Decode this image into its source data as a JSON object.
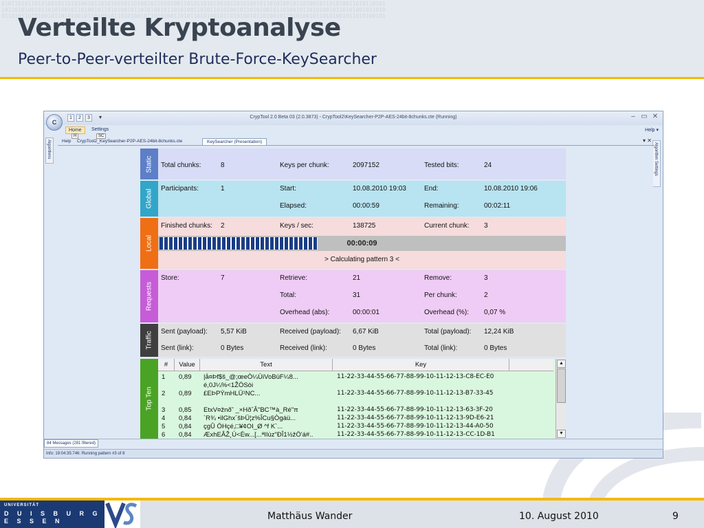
{
  "slide": {
    "title": "Verteilte Kryptoanalyse",
    "subtitle": "Peer-to-Peer-verteilter Brute-Force-KeySearcher",
    "binary_pattern": "01011010110101001011010100101101010010110100101101010011010110101001011010100101101010010110100101101010011010110101\n10110101001011010100101101001011010100101101010010110101001101011010100101101010010110100101101010010110101001011010\n01101011010100101101010010110100101101010010110101001101011010100101101010010110100101101010010110101001011010100101"
  },
  "window": {
    "orb_label": "C",
    "quick_access": [
      "1",
      "2",
      "3"
    ],
    "qa_more": "▾",
    "title": "CrypTool 2.0 Beta 03 (2.0.3873) - CrypTool2\\KeySearcher-P2P-AES-24bit-8chunks.cte (Running)",
    "controls": [
      "–",
      "▭",
      "✕"
    ],
    "ribbon_tabs": [
      "Home",
      "Settings"
    ],
    "keytips": [
      "H",
      "SC"
    ],
    "help": "Help ▾",
    "doc_tabs": [
      "Help",
      "CrypTool2_KeySearcher-P2P-AES-24bit-8chunks.cte",
      "KeySearcher (Presentation)"
    ],
    "tab_controls": "▾ ✕",
    "left_side_label": "Algorithms",
    "right_side_label": "Algorithm Settings",
    "messages_tab": "84 Messages (281 filtered)",
    "info_bar": "Info: 19:04:35:746: Running pattern #3 of 8"
  },
  "panels": {
    "static": {
      "label": "Static",
      "total_chunks_label": "Total chunks:",
      "total_chunks": "8",
      "keys_per_chunk_label": "Keys per chunk:",
      "keys_per_chunk": "2097152",
      "tested_bits_label": "Tested bits:",
      "tested_bits": "24"
    },
    "global": {
      "label": "Global",
      "participants_label": "Participants:",
      "participants": "1",
      "start_label": "Start:",
      "start": "10.08.2010 19:03",
      "end_label": "End:",
      "end": "10.08.2010 19:06",
      "elapsed_label": "Elapsed:",
      "elapsed": "00:00:59",
      "remaining_label": "Remaining:",
      "remaining": "00:02:11"
    },
    "local": {
      "label": "Local",
      "finished_chunks_label": "Finished chunks:",
      "finished_chunks": "2",
      "keys_sec_label": "Keys / sec:",
      "keys_sec": "138725",
      "current_chunk_label": "Current chunk:",
      "current_chunk": "3",
      "progress_fraction": 0.39,
      "progress_time": "00:00:09",
      "status_message": "> Calculating pattern 3 <"
    },
    "requests": {
      "label": "Requests",
      "store_label": "Store:",
      "store": "7",
      "retrieve_label": "Retrieve:",
      "retrieve": "21",
      "remove_label": "Remove:",
      "remove": "3",
      "total_label": "Total:",
      "total": "31",
      "per_chunk_label": "Per chunk:",
      "per_chunk": "2",
      "overhead_abs_label": "Overhead (abs):",
      "overhead_abs": "00:00:01",
      "overhead_pct_label": "Overhead (%):",
      "overhead_pct": "0,07 %"
    },
    "traffic": {
      "label": "Traffic",
      "sent_payload_label": "Sent (payload):",
      "sent_payload": "5,57 KiB",
      "received_payload_label": "Received (payload):",
      "received_payload": "6,67 KiB",
      "total_payload_label": "Total (payload):",
      "total_payload": "12,24 KiB",
      "sent_link_label": "Sent (link):",
      "sent_link": "0 Bytes",
      "received_link_label": "Received (link):",
      "received_link": "0 Bytes",
      "total_link_label": "Total (link):",
      "total_link": "0 Bytes"
    },
    "topten": {
      "label": "Top Ten",
      "columns": [
        "#",
        "Value",
        "Text",
        "Key"
      ],
      "rows": [
        {
          "num": "1",
          "value": "0,89",
          "text": "|å¤Þf$š_@;œeÒ¼ÙiVoBüF¼8...",
          "key": "11-22-33-44-55-66-77-88-99-10-11-12-13-C8-EC-E0"
        },
        {
          "num": "",
          "value": "",
          "text": "é,0J¼%<1ŽÖSòi",
          "key": ""
        },
        {
          "num": "2",
          "value": "0,89",
          "text": "£EÞPÝmHLÜ¹NC...",
          "key": "11-22-33-44-55-66-77-88-99-10-11-12-13-B7-33-45"
        },
        {
          "num": "",
          "value": "",
          "text": "",
          "key": ""
        },
        {
          "num": "3",
          "value": "0,85",
          "text": "EtxV¤žnð˜    _×HðˆÂ\"BC™à_Ré\"π",
          "key": "11-22-33-44-55-66-77-88-99-10-11-12-13-63-3F-20"
        },
        {
          "num": "4",
          "value": "0,84",
          "text": "`R¾ •ïlGhx´šÞÜ¦z%ÎCu§Ògáü...",
          "key": "11-22-33-44-55-66-77-88-99-10-11-12-13-9D-E6-21"
        },
        {
          "num": "5",
          "value": "0,84",
          "text": "çgÛ ÖHçé,□¥¢OI_Ø      ^f K`...",
          "key": "11-22-33-44-55-66-77-88-99-10-11-12-13-44-A0-50"
        },
        {
          "num": "6",
          "value": "0,84",
          "text": "ÆxhEÂŽ¸Ú<Èw...[...ªIIùz\"ÐÎ1½žÖ'á#..",
          "key": "11-22-33-44-55-66-77-88-99-10-11-12-13-CC-1D-B1"
        }
      ]
    }
  },
  "footer": {
    "uni_small": "UNIVERSITÄT",
    "uni_line1": "D U I S B U R G",
    "uni_line2": "E S S E N",
    "author": "Matthäus Wander",
    "date": "10. August 2010",
    "page": "9"
  },
  "colors": {
    "accent_rule": "#f5b800",
    "static": "#5d7fc8",
    "global": "#32a6c8",
    "local": "#ef6f14",
    "requests": "#c65cd7",
    "traffic": "#3f3f3f",
    "topten": "#4aa324",
    "progress": "#1a3d86",
    "uni_blue": "#1b3a73"
  }
}
